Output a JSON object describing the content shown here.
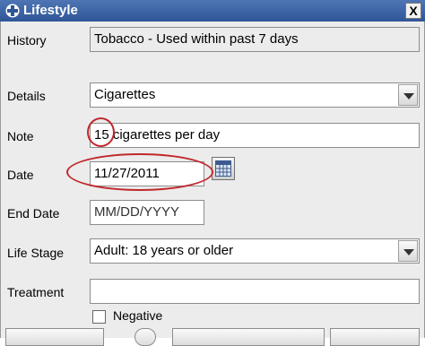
{
  "window": {
    "title": "Lifestyle",
    "close_label": "X",
    "title_icon": "lifestyle-cross-icon"
  },
  "form": {
    "history": {
      "label": "History",
      "value": "Tobacco - Used within past 7 days"
    },
    "details": {
      "label": "Details",
      "value": "Cigarettes"
    },
    "note": {
      "label": "Note",
      "value": "15 cigarettes per day"
    },
    "date": {
      "label": "Date",
      "value": "11/27/2011"
    },
    "end_date": {
      "label": "End Date",
      "value": "MM/DD/YYYY"
    },
    "life_stage": {
      "label": "Life Stage",
      "value": "Adult: 18 years or older"
    },
    "treatment": {
      "label": "Treatment",
      "value": ""
    },
    "negative": {
      "label": "Negative",
      "checked": false
    }
  },
  "annotations": {
    "color": "#c0282d"
  },
  "colors": {
    "titlebar": "#3a63a8",
    "panel": "#ececec"
  }
}
